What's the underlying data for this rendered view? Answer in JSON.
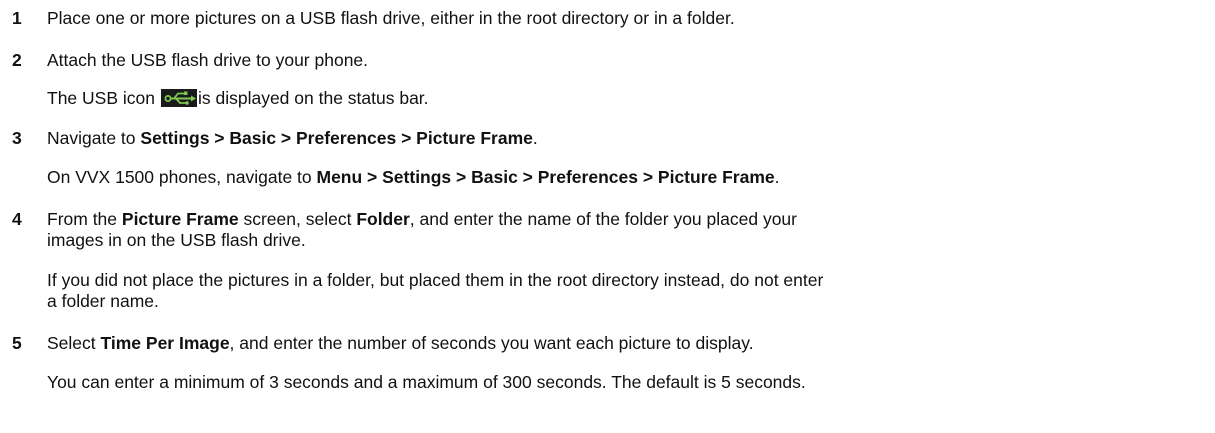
{
  "steps": [
    {
      "number": "1",
      "text": "Place one or more pictures on a USB flash drive, either in the root directory or in a folder."
    },
    {
      "number": "2",
      "text": "Attach the USB flash drive to your phone.",
      "note_before_icon": "The USB icon",
      "note_icon": "usb-icon",
      "note_after_icon": "is displayed on the status bar."
    },
    {
      "number": "3",
      "text_prefix": "Navigate to ",
      "text_bold": "Settings > Basic > Preferences > Picture Frame",
      "text_suffix": ".",
      "note_prefix": "On VVX 1500 phones, navigate to ",
      "note_bold": "Menu > Settings > Basic > Preferences > Picture Frame",
      "note_suffix": "."
    },
    {
      "number": "4",
      "text_1": "From the ",
      "text_bold_1": "Picture Frame",
      "text_2": " screen, select ",
      "text_bold_2": "Folder",
      "text_3": ", and enter the name of the folder you placed your",
      "text_line2": "images in on the USB flash drive.",
      "note_line1": "If you did not place the pictures in a folder, but placed them in the root directory instead, do not enter",
      "note_line2": "a folder name."
    },
    {
      "number": "5",
      "text_prefix": "Select ",
      "text_bold": "Time Per Image",
      "text_suffix": ", and enter the number of seconds you want each picture to display.",
      "note": "You can enter a minimum of 3 seconds and a maximum of 300 seconds. The default is 5 seconds."
    }
  ],
  "colors": {
    "text": "#111111",
    "usb_icon_bg": "#1a1a1a",
    "usb_icon_symbol": "#7ec850"
  }
}
